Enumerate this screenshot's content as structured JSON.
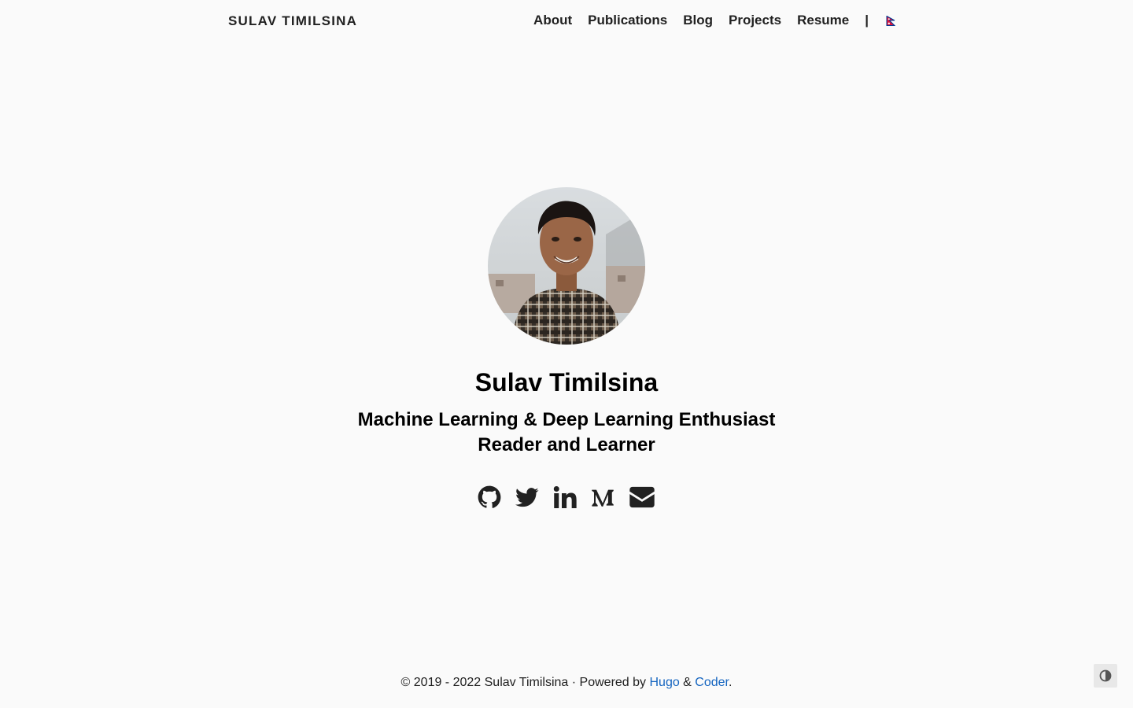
{
  "header": {
    "brand": "SULAV TIMILSINA",
    "nav": [
      {
        "label": "About"
      },
      {
        "label": "Publications"
      },
      {
        "label": "Blog"
      },
      {
        "label": "Projects"
      },
      {
        "label": "Resume"
      }
    ],
    "separator": "|",
    "language_icon": "nepal-flag-icon"
  },
  "profile": {
    "avatar_icon": "profile-photo",
    "name": "Sulav Timilsina",
    "tagline_line1": "Machine Learning & Deep Learning Enthusiast",
    "tagline_line2": "Reader and Learner",
    "social": [
      {
        "icon": "github-icon"
      },
      {
        "icon": "twitter-icon"
      },
      {
        "icon": "linkedin-icon"
      },
      {
        "icon": "medium-icon"
      },
      {
        "icon": "email-icon"
      }
    ]
  },
  "footer": {
    "copyright": "© 2019 - 2022 Sulav Timilsina · Powered by ",
    "hugo": "Hugo",
    "amp": " & ",
    "coder": "Coder",
    "period": "."
  },
  "theme_toggle_icon": "contrast-icon",
  "colors": {
    "background": "#fafafa",
    "text": "#212121",
    "link": "#1565c0"
  }
}
